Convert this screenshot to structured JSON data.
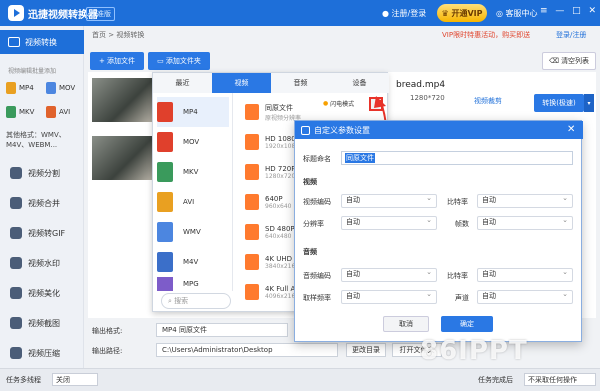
{
  "app": {
    "title": "迅捷视频转换器",
    "edition": "标准版",
    "login": "注册/登录",
    "vip": "开通VIP",
    "service": "客服中心"
  },
  "sidebar": {
    "active": "视频转换",
    "sub_hint": "视频编辑批量添加",
    "formats": [
      "MP4",
      "MOV",
      "MKV",
      "AVI"
    ],
    "other_formats": "其他格式：WMV、M4V、WEBM...",
    "items": [
      "视频分割",
      "视频合并",
      "视频转GIF",
      "视频水印",
      "视频美化",
      "视频截图",
      "视频压缩"
    ]
  },
  "header": {
    "breadcrumb": "首页 > 视频转换",
    "vip_promo": "VIP限时特惠活动，购买即送",
    "login_link": "登录/注册"
  },
  "toolbar": {
    "add_file": "添加文件",
    "add_folder": "添加文件夹",
    "clear_list": "清空列表"
  },
  "file": {
    "name": "bread.mp4",
    "resolution": "1280*720",
    "crop": "视频裁剪",
    "convert": "转换(极速)",
    "dropdown": "▾"
  },
  "picker": {
    "tabs": [
      "最近",
      "视频",
      "音频",
      "设备"
    ],
    "formats": [
      "MP4",
      "MOV",
      "MKV",
      "AVI",
      "WMV",
      "M4V",
      "MPG"
    ],
    "search_placeholder": "搜索",
    "resolutions": [
      {
        "name": "同原文件",
        "sub": "原视频分辨率"
      },
      {
        "name": "HD 1080P",
        "sub": "1920x1080"
      },
      {
        "name": "HD 720P",
        "sub": "1280x720"
      },
      {
        "name": "640P",
        "sub": "960x640"
      },
      {
        "name": "SD 480P",
        "sub": "640x480"
      },
      {
        "name": "4K UHD",
        "sub": "3840x2160"
      },
      {
        "name": "4K Full A",
        "sub": "4096x2160"
      }
    ],
    "flash_mode": "闪电模式"
  },
  "dialog": {
    "title": "自定义参数设置",
    "name_label": "标题命名",
    "name_value": "同原文件",
    "video_section": "视频",
    "audio_section": "音频",
    "labels": {
      "video_codec": "视频编码",
      "resolution": "分辨率",
      "bitrate": "比特率",
      "fps": "帧数",
      "audio_codec": "音频编码",
      "sample_rate": "取样频率",
      "channel": "声道"
    },
    "auto": "自动",
    "cancel": "取消",
    "ok": "确定"
  },
  "output": {
    "format_label": "输出格式:",
    "format_value": "MP4  同原文件",
    "path_label": "输出路径:",
    "path_value": "C:\\Users\\Administrator\\Desktop",
    "change_dir": "更改目录",
    "open_folder": "打开文件夹"
  },
  "status": {
    "multi_thread": "任务多线程",
    "off": "关闭",
    "task_done": "任务完成后",
    "no_action": "不采取任何操作"
  },
  "watermark": "86IPPT",
  "colors": {
    "primary": "#2a78e4",
    "accent": "#e8332a",
    "vip": "#f7b500"
  }
}
